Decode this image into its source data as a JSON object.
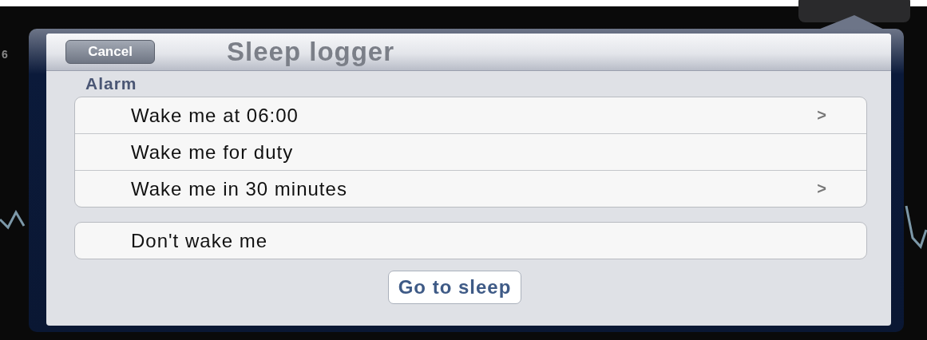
{
  "background": {
    "axis_label": "6"
  },
  "popover": {
    "cancel": "Cancel",
    "title": "Sleep logger",
    "section": "Alarm",
    "groups": [
      {
        "rows": [
          {
            "label": "Wake me at 06:00",
            "accessory": ">"
          },
          {
            "label": "Wake me for duty"
          },
          {
            "label": "Wake me in 30 minutes",
            "accessory": ">"
          }
        ]
      },
      {
        "rows": [
          {
            "label": "Don't wake me"
          }
        ]
      }
    ],
    "action": "Go to sleep"
  }
}
